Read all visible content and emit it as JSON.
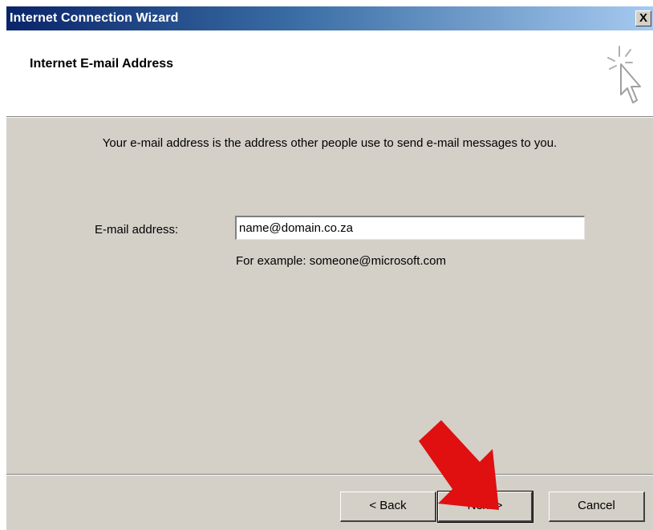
{
  "window": {
    "title": "Internet Connection Wizard",
    "close_label": "X"
  },
  "header": {
    "title": "Internet E-mail Address",
    "icon": "wizard-cursor-icon"
  },
  "content": {
    "intro": "Your e-mail address is the address other people use to send e-mail messages to you.",
    "email_label": "E-mail address:",
    "email_value": "name@domain.co.za",
    "example": "For example: someone@microsoft.com"
  },
  "buttons": {
    "back": "< Back",
    "next": "Next >",
    "cancel": "Cancel"
  },
  "annotation": {
    "icon": "red-arrow-icon",
    "color": "#e01010"
  }
}
